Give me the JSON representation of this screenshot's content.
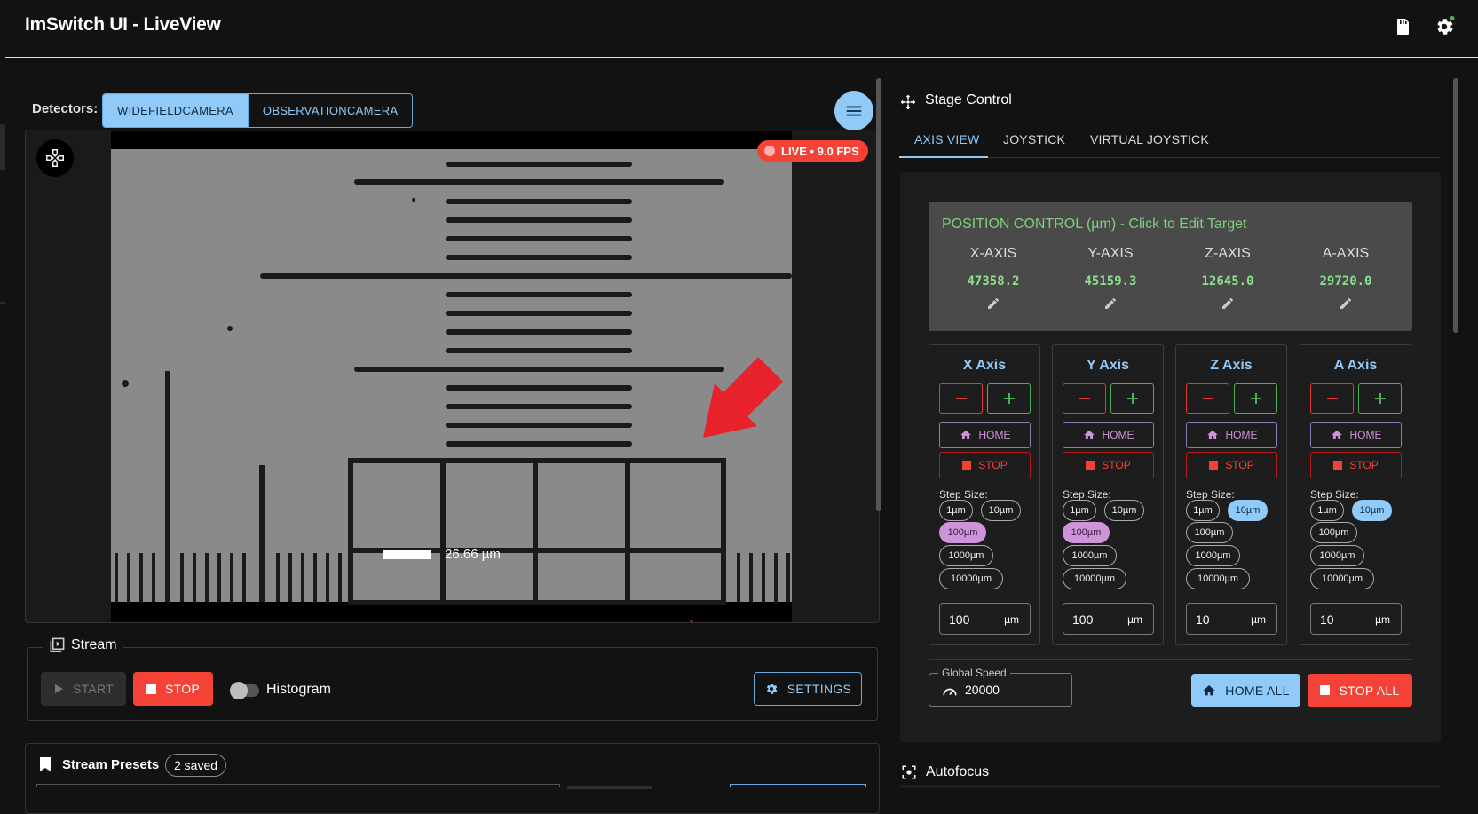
{
  "app": {
    "title": "ImSwitch UI - LiveView"
  },
  "detectors": {
    "label": "Detectors:",
    "options": [
      "WIDEFIELDCAMERA",
      "OBSERVATIONCAMERA"
    ],
    "selected": "WIDEFIELDCAMERA"
  },
  "viewer": {
    "live_badge": "LIVE • 9.0 FPS",
    "scale_bar": "26.66 µm"
  },
  "stream": {
    "title": "Stream",
    "start_label": "START",
    "stop_label": "STOP",
    "histogram_label": "Histogram",
    "histogram_on": false,
    "settings_label": "SETTINGS"
  },
  "presets": {
    "title": "Stream Presets",
    "count_label": "2 saved"
  },
  "stage": {
    "title": "Stage Control",
    "tabs": [
      "AXIS VIEW",
      "JOYSTICK",
      "VIRTUAL JOYSTICK"
    ],
    "active_tab": "AXIS VIEW",
    "position": {
      "title": "POSITION CONTROL (µm) - Click to Edit Target",
      "axes": [
        {
          "name": "X-AXIS",
          "value": "47358.2"
        },
        {
          "name": "Y-AXIS",
          "value": "45159.3"
        },
        {
          "name": "Z-AXIS",
          "value": "12645.0"
        },
        {
          "name": "A-AXIS",
          "value": "29720.0"
        }
      ]
    },
    "home_label": "HOME",
    "stop_label": "STOP",
    "step_size_label": "Step Size:",
    "step_options": [
      "1µm",
      "10µm",
      "100µm",
      "1000µm",
      "10000µm"
    ],
    "unit": "µm",
    "axes": [
      {
        "title": "X Axis",
        "selected_step": "100µm",
        "step_value": "100"
      },
      {
        "title": "Y Axis",
        "selected_step": "100µm",
        "step_value": "100"
      },
      {
        "title": "Z Axis",
        "selected_step": "10µm",
        "step_value": "10"
      },
      {
        "title": "A Axis",
        "selected_step": "10µm",
        "step_value": "10"
      }
    ],
    "global_speed_label": "Global Speed",
    "global_speed_value": "20000",
    "home_all_label": "HOME ALL",
    "stop_all_label": "STOP ALL"
  },
  "autofocus": {
    "title": "Autofocus"
  },
  "colors": {
    "accent": "#90caf9",
    "danger": "#f44336",
    "success": "#4caf50",
    "home": "#ce93d8",
    "position_text": "#8be08b"
  },
  "icons": {
    "top_right": [
      "sd-card-icon",
      "settings-gear-icon"
    ],
    "stage": "move-arrows-icon",
    "stream": "video-library-icon",
    "presets": "bookmark-icon",
    "autofocus": "focus-target-icon"
  }
}
